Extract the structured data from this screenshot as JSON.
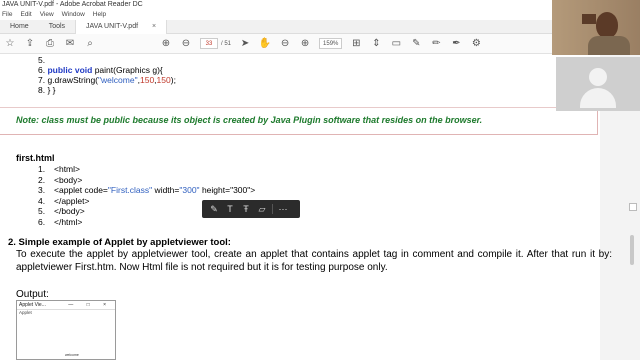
{
  "window": {
    "title": "JAVA UNIT-V.pdf - Adobe Acrobat Reader DC"
  },
  "menu": [
    "File",
    "Edit",
    "View",
    "Window",
    "Help"
  ],
  "tabs": {
    "home": "Home",
    "tools": "Tools",
    "document": "JAVA UNIT-V.pdf",
    "close": "×"
  },
  "toolbar": {
    "page_current": "33",
    "page_total": "/ 51",
    "zoom": "159%"
  },
  "code": {
    "line5": "5.",
    "line6_num": "6.",
    "line6_kw": "public void",
    "line6_rest": " paint(Graphics g){",
    "line7_num": "7.",
    "line7_pre": "g.drawString(",
    "line7_str": "\"welcome\"",
    "line7_mid": ",",
    "line7_n1": "150",
    "line7_comma": ",",
    "line7_n2": "150",
    "line7_end": ");",
    "line8_num": "8.",
    "line8_text": "} }"
  },
  "note": "Note: class must be public because its object is created by Java Plugin software that resides on the browser.",
  "first_html": {
    "heading": "first.html",
    "lines": [
      {
        "n": "1.",
        "pre": "<html>",
        "attr1": "",
        "mid": "",
        "attr2": "",
        "post": ""
      },
      {
        "n": "2.",
        "pre": "<body>",
        "attr1": "",
        "mid": "",
        "attr2": "",
        "post": ""
      },
      {
        "n": "3.",
        "pre": "<applet code=",
        "attr1": "\"First.class\"",
        "mid": " width=",
        "attr2": "\"300\"",
        "post": " height=\"300\">"
      },
      {
        "n": "4.",
        "pre": "</applet>",
        "attr1": "",
        "mid": "",
        "attr2": "",
        "post": ""
      },
      {
        "n": "5.",
        "pre": "</body>",
        "attr1": "",
        "mid": "",
        "attr2": "",
        "post": ""
      },
      {
        "n": "6.",
        "pre": "</html>",
        "attr1": "",
        "mid": "",
        "attr2": "",
        "post": ""
      }
    ]
  },
  "section2": {
    "heading": "2.  Simple example of Applet by appletviewer tool:",
    "paragraph": "To execute the applet by appletviewer tool, create an applet that contains applet tag in comment and compile it. After that run it by: appletviewer First.htm. Now Html file is not required but it is for testing purpose only.",
    "output_label": "Output:"
  },
  "applet_window": {
    "title": "Applet Vie...",
    "controls": "— □ ×",
    "status": "Applet",
    "text": "welcome"
  },
  "annotation_toolbar": {
    "icons": [
      "pen-icon",
      "text-icon",
      "strike-icon",
      "eraser-icon",
      "more-icon"
    ]
  }
}
